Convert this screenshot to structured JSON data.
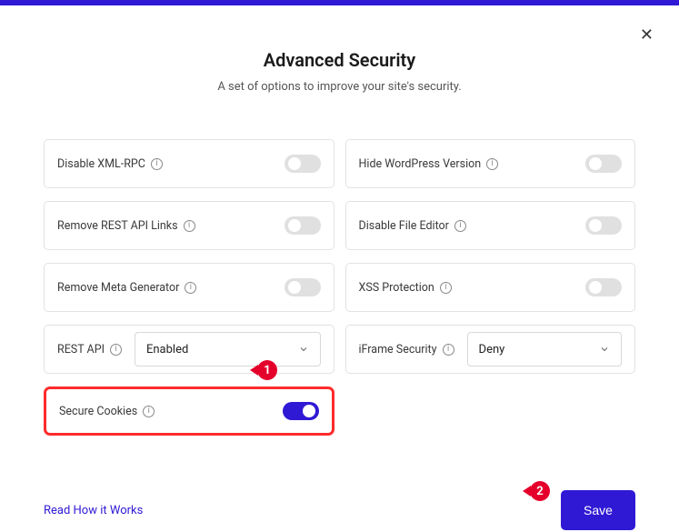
{
  "header": {
    "title": "Advanced Security",
    "subtitle": "A set of options to improve your site's security."
  },
  "options": {
    "disable_xmlrpc": {
      "label": "Disable XML-RPC",
      "on": false
    },
    "hide_wp_version": {
      "label": "Hide WordPress Version",
      "on": false
    },
    "remove_rest_links": {
      "label": "Remove REST API Links",
      "on": false
    },
    "disable_file_editor": {
      "label": "Disable File Editor",
      "on": false
    },
    "remove_meta_gen": {
      "label": "Remove Meta Generator",
      "on": false
    },
    "xss_protection": {
      "label": "XSS Protection",
      "on": false
    },
    "rest_api": {
      "label": "REST API",
      "value": "Enabled"
    },
    "iframe_security": {
      "label": "iFrame Security",
      "value": "Deny"
    },
    "secure_cookies": {
      "label": "Secure Cookies",
      "on": true
    }
  },
  "footer": {
    "help_link": "Read How it Works",
    "save": "Save"
  },
  "callouts": {
    "c1": "1",
    "c2": "2"
  }
}
